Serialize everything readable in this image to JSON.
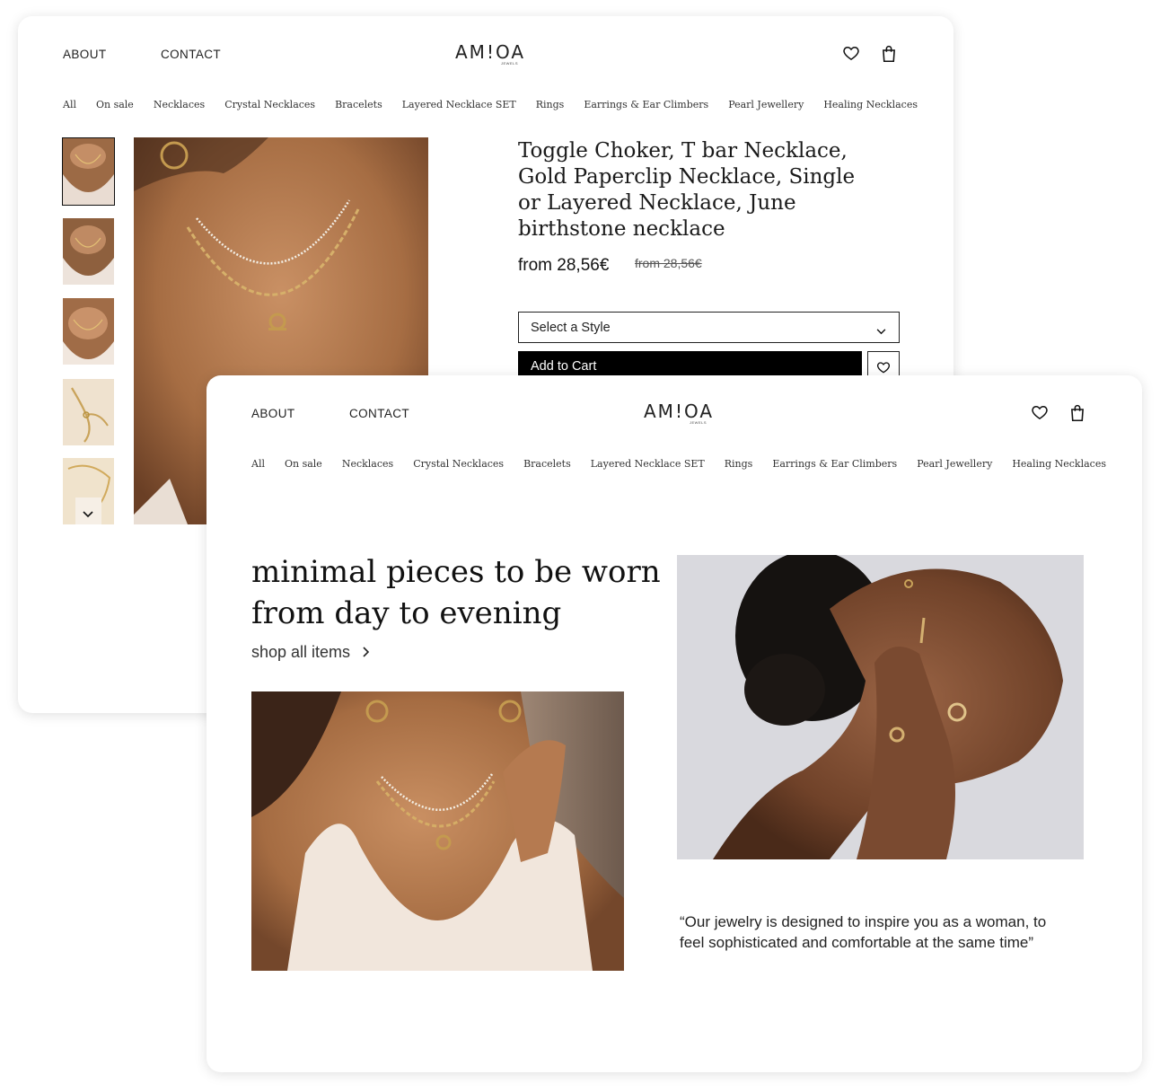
{
  "header": {
    "nav": [
      "ABOUT",
      "CONTACT"
    ],
    "logo": "AM!OA",
    "logo_sub": "JEWELS",
    "icons": [
      "heart-icon",
      "bag-icon"
    ]
  },
  "categories": [
    "All",
    "On sale",
    "Necklaces",
    "Crystal Necklaces",
    "Bracelets",
    "Layered Necklace SET",
    "Rings",
    "Earrings & Ear Climbers",
    "Pearl Jewellery",
    "Healing Necklaces"
  ],
  "product": {
    "title": "Toggle Choker, T bar Necklace, Gold Paperclip Necklace, Single or Layered Necklace, June birthstone necklace",
    "price": "from 28,56€",
    "old_price": "from 28,56€",
    "select_label": "Select a Style",
    "add_to_cart": "Add to Cart",
    "thumbnail_count": 5,
    "selected_thumbnail": 1
  },
  "home": {
    "headline": "minimal pieces to be worn from day to evening",
    "shop_link": "shop all items",
    "quote": "“Our jewelry is designed to inspire you as a woman, to feel sophisticated and comfortable at the same time”"
  },
  "colors": {
    "primary": "#000000",
    "background": "#ffffff",
    "text": "#111111",
    "photo_backdrop": "#d9d9de"
  }
}
